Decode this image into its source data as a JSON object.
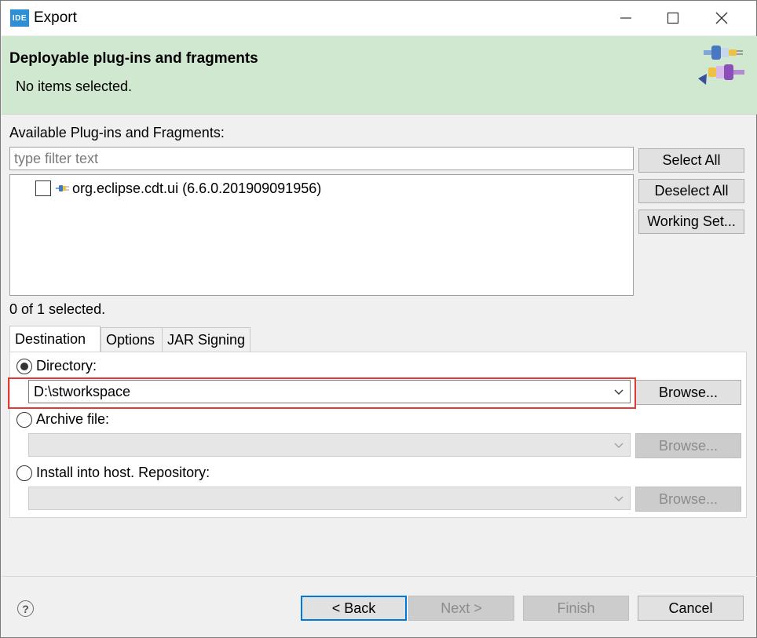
{
  "window": {
    "app_icon": "IDE",
    "title": "Export"
  },
  "banner": {
    "title": "Deployable plug-ins and fragments",
    "message": "No items selected.",
    "icon": "plugin-connector-icon"
  },
  "available": {
    "label": "Available Plug-ins and Fragments:",
    "filter_placeholder": "type filter text",
    "items": [
      {
        "label": "org.eclipse.cdt.ui (6.6.0.201909091956)",
        "checked": false
      }
    ],
    "count_text": "0 of 1 selected.",
    "buttons": {
      "select_all": "Select All",
      "deselect_all": "Deselect All",
      "working_set": "Working Set..."
    }
  },
  "tabs": [
    {
      "label": "Destination",
      "active": true
    },
    {
      "label": "Options",
      "active": false
    },
    {
      "label": "JAR Signing",
      "active": false
    }
  ],
  "destination": {
    "directory_label": "Directory:",
    "directory_value": "D:\\stworkspace",
    "directory_selected": true,
    "archive_label": "Archive file:",
    "archive_value": "",
    "install_label": "Install into host. Repository:",
    "install_value": "",
    "browse_label": "Browse..."
  },
  "footer": {
    "back": "< Back",
    "next": "Next >",
    "finish": "Finish",
    "cancel": "Cancel"
  },
  "colors": {
    "banner_bg": "#cfe8cf",
    "highlight": "#e53935",
    "default_button_border": "#0078d7"
  }
}
